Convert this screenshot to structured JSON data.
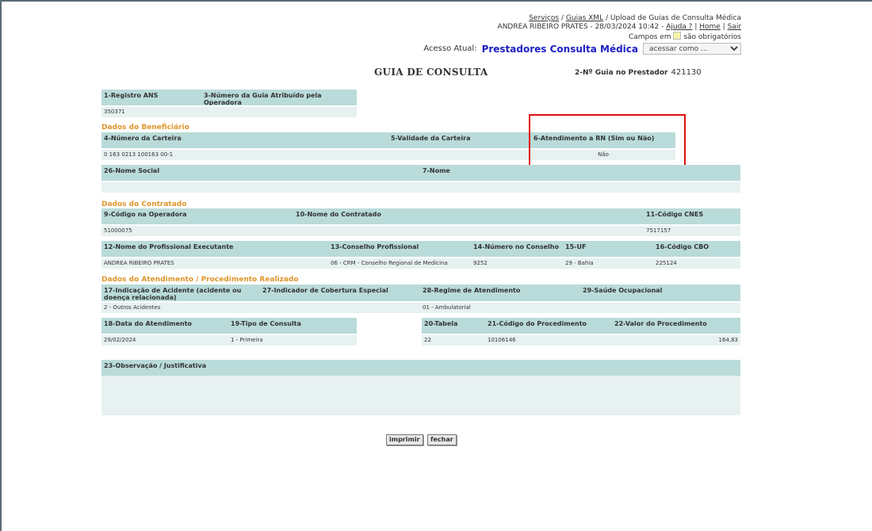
{
  "header": {
    "breadcrumb": {
      "servicos": "Serviços",
      "sep1": " / ",
      "guias_xml": "Guias XML",
      "sep2": " / ",
      "current": "Upload de Guias de Consulta Médica"
    },
    "user_line": "ANDREA RIBEIRO PRATES - 28/03/2024 10:42 - ",
    "ajuda": "Ajuda ?",
    "sep_pipe1": " | ",
    "home": "Home",
    "sep_pipe2": " | ",
    "sair": "Sair",
    "required_prefix": "Campos em",
    "required_suffix": "são obrigatórios",
    "acesso_label": "Acesso Atual:",
    "acesso_perfil": "Prestadores Consulta Médica",
    "acessar_como": "acessar como ..."
  },
  "title": "GUIA DE CONSULTA",
  "num_prestador": {
    "label": "2-Nº Guia no Prestador",
    "value": "421130"
  },
  "fields": {
    "registro_ans": {
      "label": "1-Registro ANS",
      "value": "350371"
    },
    "num_guia_operadora": {
      "label": "3-Número da Guia Atribuído pela Operadora",
      "value": ""
    },
    "num_carteira": {
      "label": "4-Número da Carteira",
      "value": "0 163 0213 100163 00-1"
    },
    "validade_carteira": {
      "label": "5-Validade da Carteira",
      "value": ""
    },
    "atendimento_rn": {
      "label": "6-Atendimento a RN (Sim ou Não)",
      "value": "Não"
    },
    "nome_social": {
      "label": "26-Nome Social",
      "value": ""
    },
    "nome": {
      "label": "7-Nome",
      "value": ""
    },
    "codigo_operadora": {
      "label": "9-Código na Operadora",
      "value": "51000075"
    },
    "nome_contratado": {
      "label": "10-Nome do Contratado",
      "value": ""
    },
    "codigo_cnes": {
      "label": "11-Código CNES",
      "value": "7517157"
    },
    "nome_profissional": {
      "label": "12-Nome do Profissional Executante",
      "value": "ANDREA RIBEIRO PRATES"
    },
    "conselho_profissional": {
      "label": "13-Conselho Profissional",
      "value": "06 -  CRM - Conselho Regional de Medicina"
    },
    "numero_conselho": {
      "label": "14-Número no Conselho",
      "value": "9252"
    },
    "uf": {
      "label": "15-UF",
      "value": "29 -  Bahia"
    },
    "codigo_cbo": {
      "label": "16-Código CBO",
      "value": "225124"
    },
    "indicacao_acidente": {
      "label": "17-Indicação de Acidente (acidente ou doença relacionada)",
      "value": "2 - Outros Acidentes"
    },
    "cobertura_especial": {
      "label": "27-Indicador de Cobertura Especial",
      "value": ""
    },
    "regime_atendimento": {
      "label": "28-Regime de Atendimento",
      "value": "01 - Ambulatorial"
    },
    "saude_ocupacional": {
      "label": "29-Saúde Ocupacional",
      "value": ""
    },
    "data_atendimento": {
      "label": "18-Data do Atendimento",
      "value": "29/02/2024"
    },
    "tipo_consulta": {
      "label": "19-Tipo de Consulta",
      "value": "1 - Primeira"
    },
    "tabela": {
      "label": "20-Tabela",
      "value": "22"
    },
    "codigo_procedimento": {
      "label": "21-Código do Procedimento",
      "value": "10106146"
    },
    "valor_procedimento": {
      "label": "22-Valor do Procedimento",
      "value": "164,83"
    },
    "observacao": {
      "label": "23-Observação / Justificativa",
      "value": ""
    }
  },
  "sections": {
    "beneficiario": "Dados do Beneficiário",
    "contratado": "Dados do Contratado",
    "atendimento": "Dados do Atendimento / Procedimento Realizado"
  },
  "buttons": {
    "imprimir": "imprimir",
    "fechar": "fechar"
  },
  "colors": {
    "label_bg": "#b9dbd9",
    "value_bg": "#e6f1f0",
    "section": "#e0962c",
    "highlight": "#e0100f",
    "perfil": "#1d1fc4"
  }
}
